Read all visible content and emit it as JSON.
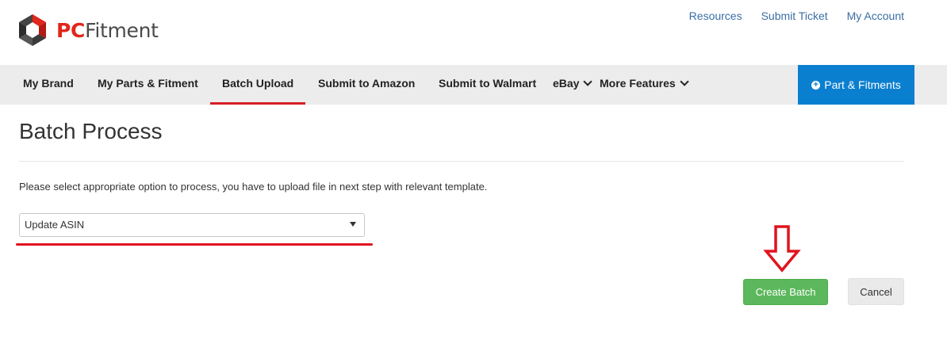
{
  "header": {
    "logo": {
      "brand_part1": "PC",
      "brand_part2": "Fitment",
      "icon": "pcfitment-hex-logo-icon"
    },
    "top_links": [
      {
        "label": "Resources"
      },
      {
        "label": "Submit Ticket"
      },
      {
        "label": "My Account"
      }
    ]
  },
  "nav": {
    "items": [
      {
        "label": "My Brand"
      },
      {
        "label": "My Parts & Fitment"
      },
      {
        "label": "Batch Upload",
        "active": true
      },
      {
        "label": "Submit to Amazon"
      },
      {
        "label": "Submit to Walmart"
      },
      {
        "label": "eBay",
        "icon": "chevron-down-icon"
      },
      {
        "label": "More Features",
        "icon": "chevron-down-icon"
      }
    ],
    "cta": {
      "label": "Part & Fitments",
      "icon": "plus-circle-icon"
    }
  },
  "main": {
    "title": "Batch Process",
    "instruction": "Please select appropriate option to process, you have to upload file in next step with relevant template.",
    "process_select": {
      "value": "Update ASIN",
      "icon": "caret-down-icon"
    },
    "buttons": {
      "create": "Create Batch",
      "cancel": "Cancel"
    },
    "annotation_icon": "red-down-arrow-icon"
  },
  "colors": {
    "brand_red": "#e1261c",
    "nav_bg": "#ececec",
    "active_underline": "#d71f26",
    "cta_blue": "#0a7fd0",
    "link_blue": "#3b6ea5",
    "success_green": "#5cb85c",
    "annotation_red": "#e0141e"
  }
}
